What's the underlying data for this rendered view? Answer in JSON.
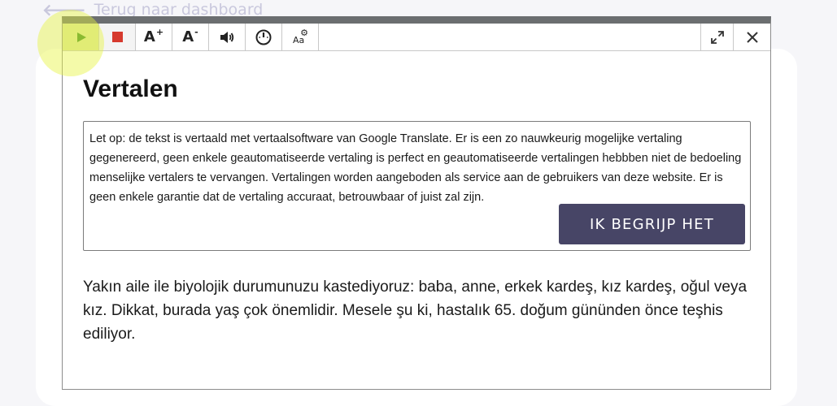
{
  "back_link": {
    "label": "Terug naar dashboard"
  },
  "toolbar": {
    "play": "play-icon",
    "stop": "stop-icon",
    "font_increase": "A",
    "font_increase_sign": "+",
    "font_decrease": "A",
    "font_decrease_sign": "-",
    "volume": "volume-icon",
    "speed": "speed-icon",
    "settings": "settings-icon",
    "settings_letters": "Aa",
    "expand": "expand-icon",
    "close": "close-icon"
  },
  "title": "Vertalen",
  "notice": {
    "text": "Let op: de tekst is vertaald met vertaalsoftware van Google Translate. Er is een zo nauwkeurig mogelijke vertaling gegenereerd, geen enkele geautomatiseerde vertaling is perfect en geautomatiseerde vertalingen hebbben niet de bedoeling menselijke vertalers te vervangen. Vertalingen worden aangeboden als service aan de gebruikers van deze website. Er is geen enkele garantie dat de vertaling accuraat, betrouwbaar of juist zal zijn.",
    "button_label": "IK BEGRIJP HET"
  },
  "body_text": "Yakın aile ile biyolojik durumunuzu kastediyoruz: baba, anne, erkek kardeş, kız kardeş, oğul veya kız. Dikkat, burada yaş çok önemlidir. Mesele şu ki, hastalık 65. doğum gününden önce teşhis ediliyor.",
  "colors": {
    "accent": "#474566",
    "play_active": "#dde6a1",
    "stop": "#d63a2e",
    "highlight": "#e6f440"
  }
}
